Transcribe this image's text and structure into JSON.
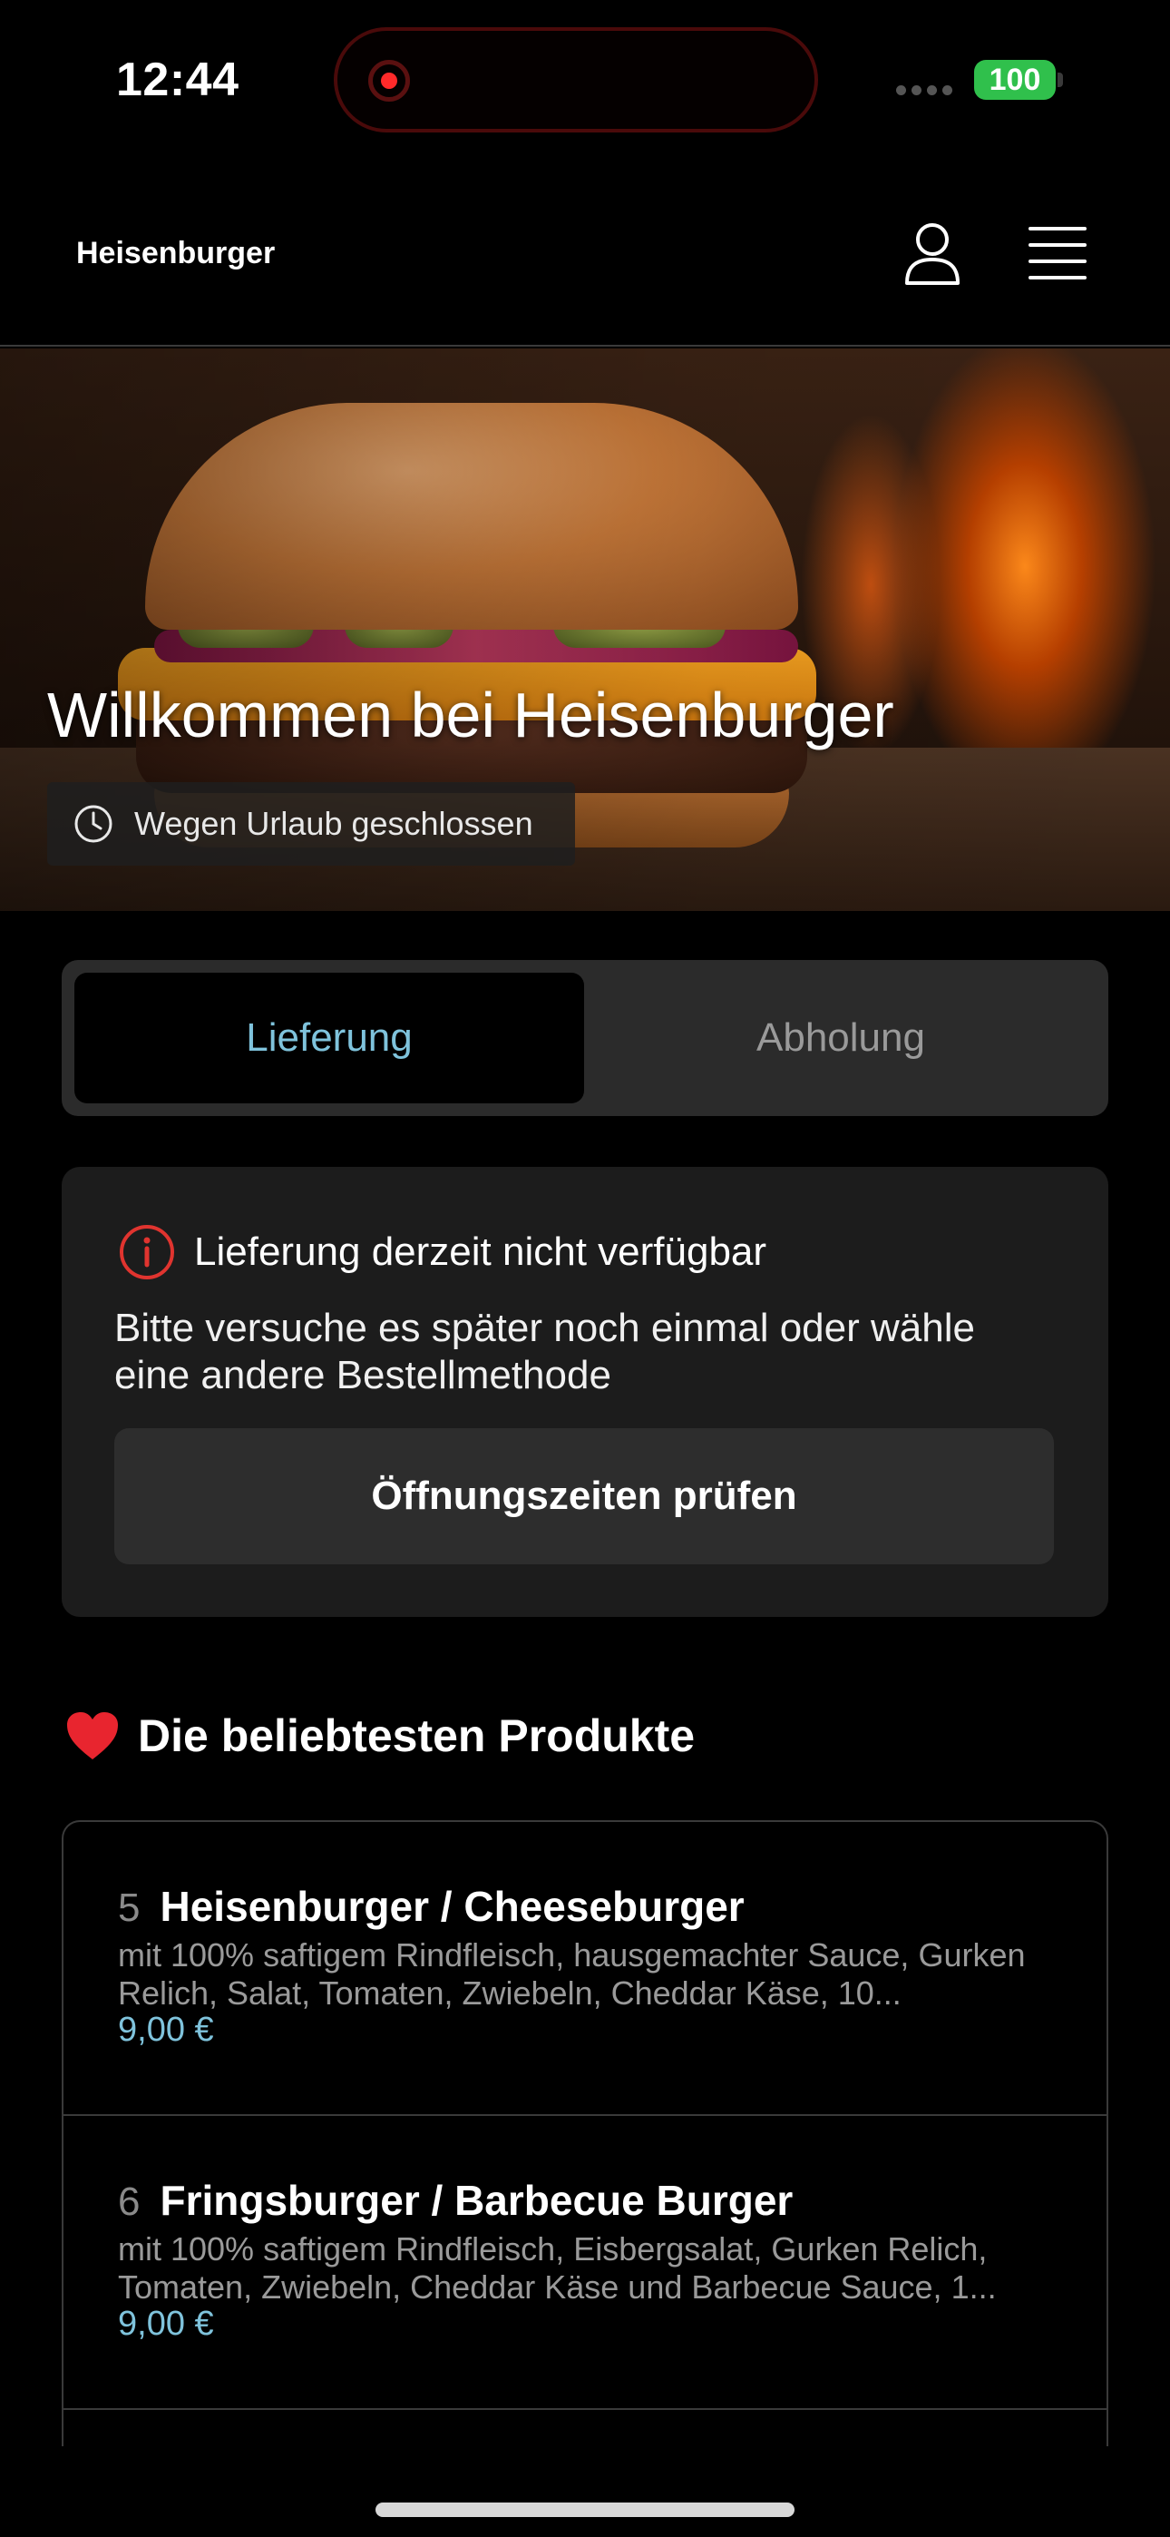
{
  "status_bar": {
    "time": "12:44",
    "battery": "100"
  },
  "header": {
    "brand": "Heisenburger",
    "icons": [
      "user-icon",
      "menu-icon"
    ]
  },
  "hero": {
    "title": "Willkommen bei Heisenburger",
    "status": "Wegen Urlaub geschlossen",
    "status_icon": "clock-icon"
  },
  "order_mode": {
    "tabs": [
      {
        "label": "Lieferung",
        "active": true
      },
      {
        "label": "Abholung",
        "active": false
      }
    ]
  },
  "notice": {
    "icon": "info-icon",
    "title": "Lieferung derzeit nicht verfügbar",
    "text": "Bitte versuche es später noch einmal oder wähle eine andere Bestellmethode",
    "button": "Öffnungszeiten prüfen"
  },
  "popular": {
    "icon": "heart-icon",
    "title": "Die beliebtesten Produkte",
    "products": [
      {
        "number": "5",
        "name": "Heisenburger / Cheeseburger",
        "description": "mit 100% saftigem Rindfleisch, hausgemachter Sauce, Gurken Relich, Salat, Tomaten,  Zwiebeln, Cheddar Käse, 10...",
        "price": "9,00 €"
      },
      {
        "number": "6",
        "name": "Fringsburger / Barbecue Burger",
        "description": "mit 100% saftigem Rindfleisch, Eisbergsalat, Gurken Relich, Tomaten,  Zwiebeln,  Cheddar Käse und  Barbecue Sauce, 1...",
        "price": "9,00 €"
      }
    ]
  },
  "colors": {
    "accent": "#7fc3dc",
    "background": "#000000",
    "card": "#1c1c1c",
    "alert": "#e0342f",
    "battery": "#30c04c"
  }
}
